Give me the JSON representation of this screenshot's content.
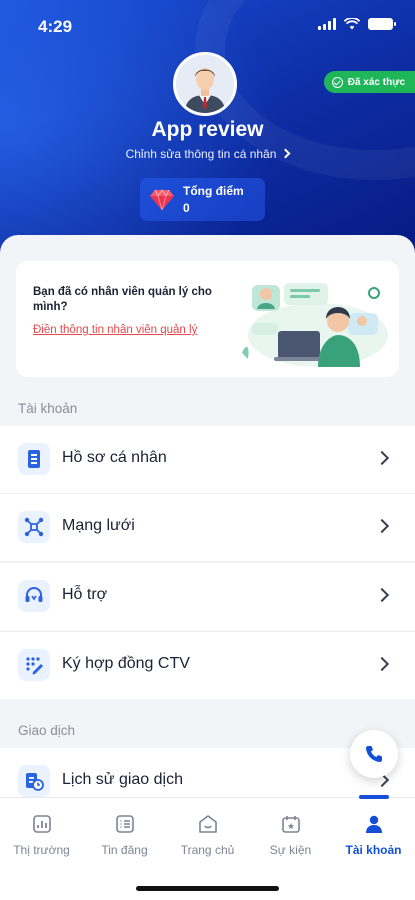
{
  "status_bar": {
    "time": "4:29"
  },
  "profile": {
    "name": "App review",
    "edit_label": "Chỉnh sửa thông tin cá nhân",
    "verified_label": "Đã xác thực",
    "points_label": "Tổng điểm",
    "points_value": "0"
  },
  "promo": {
    "text": "Bạn đã có nhân viên quản lý cho mình?",
    "link": "Điền thông tin nhân viên quản lý"
  },
  "sections": {
    "account_title": "Tài khoản",
    "transaction_title": "Giao dịch"
  },
  "account_items": [
    {
      "label": "Hồ sơ cá nhân",
      "icon": "profile-doc-icon"
    },
    {
      "label": "Mạng lưới",
      "icon": "network-icon"
    },
    {
      "label": "Hỗ trợ",
      "icon": "headset-icon"
    },
    {
      "label": "Ký hợp đồng CTV",
      "icon": "sign-contract-icon"
    }
  ],
  "transaction_items": [
    {
      "label": "Lịch sử giao dịch",
      "icon": "history-icon"
    }
  ],
  "tabs": [
    {
      "label": "Thị trường",
      "icon": "market-chart-icon",
      "active": false
    },
    {
      "label": "Tin đăng",
      "icon": "listing-icon",
      "active": false
    },
    {
      "label": "Trang chủ",
      "icon": "home-icon",
      "active": false
    },
    {
      "label": "Sự kiện",
      "icon": "calendar-event-icon",
      "active": false
    },
    {
      "label": "Tài khoản",
      "icon": "person-icon",
      "active": true
    }
  ],
  "colors": {
    "primary": "#1450d7",
    "header_dark": "#06167a",
    "verified": "#1fb65a",
    "link_red": "#e5484d"
  }
}
